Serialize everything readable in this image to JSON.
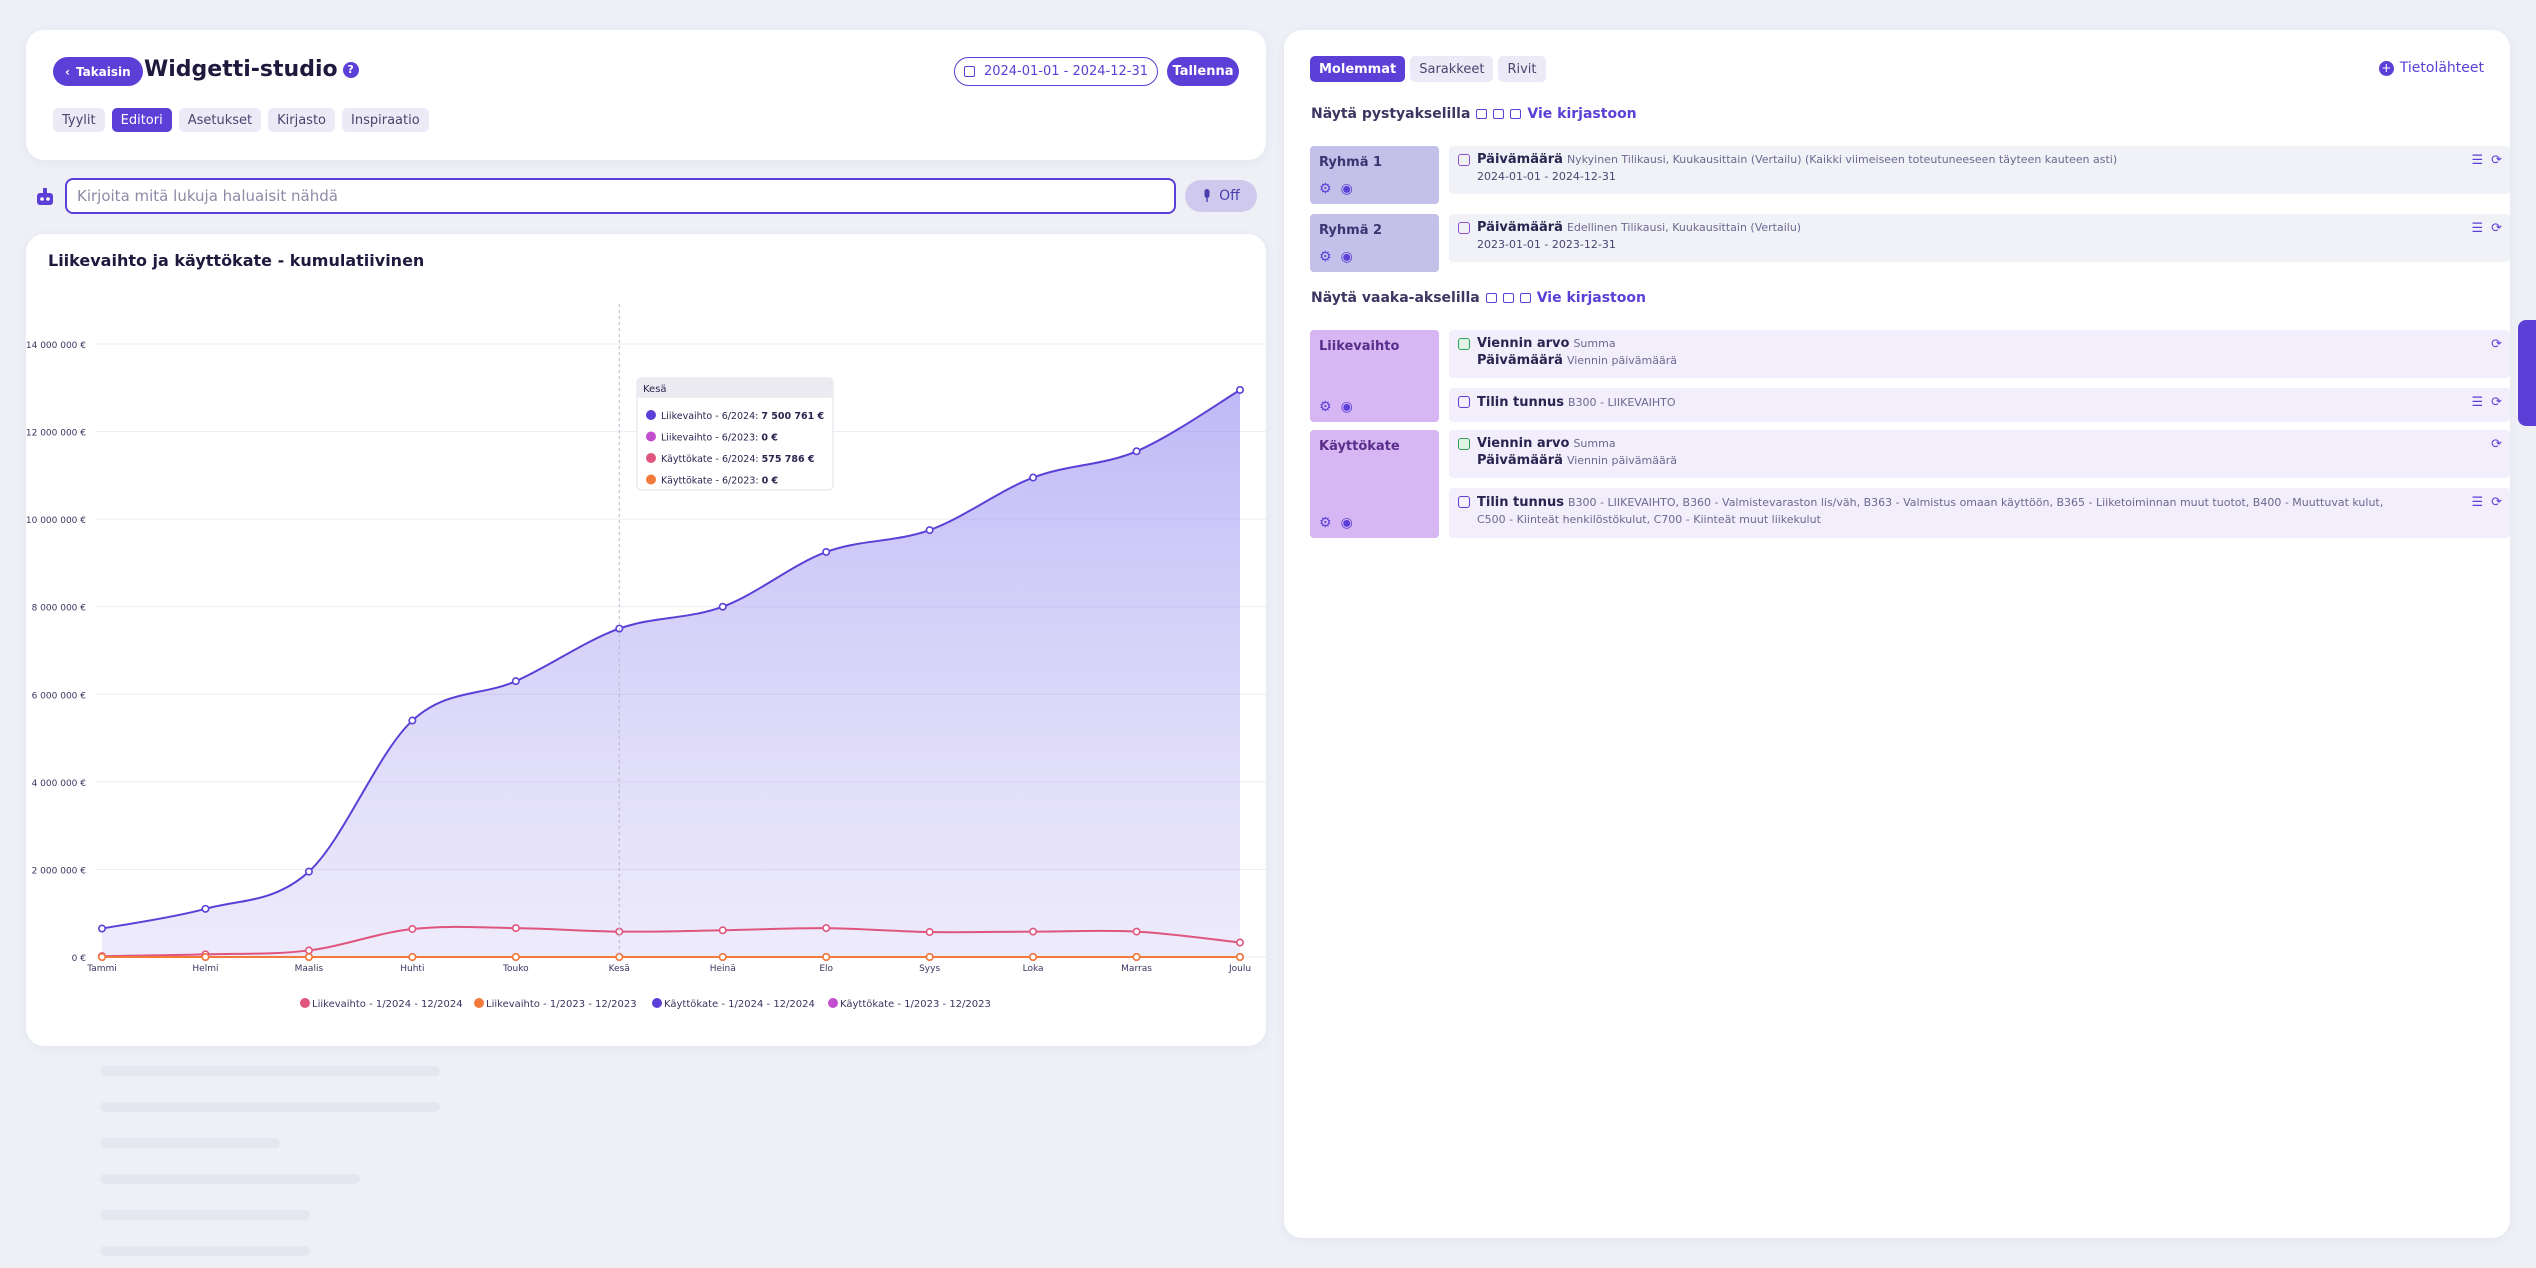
{
  "header": {
    "back_label": "Takaisin",
    "title": "Widgetti-studio",
    "help": "?",
    "date_range": "2024-01-01 - 2024-12-31",
    "save_label": "Tallenna",
    "tabs": [
      "Tyylit",
      "Editori",
      "Asetukset",
      "Kirjasto",
      "Inspiraatio"
    ],
    "active_tab": "Editori"
  },
  "prompt": {
    "placeholder": "Kirjoita mitä lukuja haluaisit nähdä",
    "mic_label": "Off"
  },
  "chart_card": {
    "title": "Liikevaihto ja käyttökate - kumulatiivinen"
  },
  "chart_data": {
    "type": "area",
    "title": "Liikevaihto ja käyttökate - kumulatiivinen",
    "categories": [
      "Tammi",
      "Helmi",
      "Maalis",
      "Huhti",
      "Touko",
      "Kesä",
      "Heinä",
      "Elo",
      "Syys",
      "Loka",
      "Marras",
      "Joulu"
    ],
    "y_ticks": [
      "0 €",
      "2 000 000 €",
      "4 000 000 €",
      "6 000 000 €",
      "8 000 000 €",
      "10 000 000 €",
      "12 000 000 €",
      "14 000 000 €"
    ],
    "ylim": [
      0,
      14000000
    ],
    "legend_position": "bottom",
    "series": [
      {
        "name": "Liikevaihto - 1/2024 - 12/2024",
        "color": "#e0557d",
        "values": [
          20000,
          60000,
          150000,
          640000,
          660000,
          580000,
          610000,
          660000,
          570000,
          580000,
          580000,
          330000
        ]
      },
      {
        "name": "Liikevaihto - 1/2023 - 12/2023",
        "color": "#f27a3a",
        "values": [
          0,
          0,
          0,
          0,
          0,
          0,
          0,
          0,
          0,
          0,
          0,
          0
        ]
      },
      {
        "name": "Käyttökate - 1/2024 - 12/2024",
        "color": "#5b3fd6",
        "values": [
          650000,
          1100000,
          1950000,
          5400000,
          6300000,
          7500761,
          8000000,
          9250000,
          9750000,
          10950000,
          11550000,
          12950000
        ]
      },
      {
        "name": "Käyttökate - 1/2023 - 12/2023",
        "color": "#c34fd0",
        "values": [
          0,
          0,
          0,
          0,
          0,
          0,
          0,
          0,
          0,
          0,
          0,
          0
        ]
      }
    ],
    "tooltip": {
      "title": "Kesä",
      "rows": [
        {
          "label": "Liikevaihto - 6/2024:",
          "value": "7 500 761 €",
          "color": "#5b3fd6"
        },
        {
          "label": "Liikevaihto - 6/2023:",
          "value": "0 €",
          "color": "#c34fd0"
        },
        {
          "label": "Käyttökate - 6/2024:",
          "value": "575 786 €",
          "color": "#e0557d"
        },
        {
          "label": "Käyttökate - 6/2023:",
          "value": "0 €",
          "color": "#f27a3a"
        }
      ]
    }
  },
  "editor": {
    "mode_tabs": [
      "Molemmat",
      "Sarakkeet",
      "Rivit"
    ],
    "active_mode": "Molemmat",
    "sources_label": "Tietolähteet",
    "vertical_title": "Näytä pystyakselilla",
    "horizontal_title": "Näytä vaaka-akselilla",
    "export_label": "Vie kirjastoon",
    "groups": [
      {
        "label": "Ryhmä 1",
        "item_title": "Päivämäärä",
        "item_desc": "Nykyinen Tilikausi, Kuukausittain (Vertailu) (Kaikki viimeiseen toteutuneeseen täyteen kauteen asti)",
        "item_date": "2024-01-01 - 2024-12-31"
      },
      {
        "label": "Ryhmä 2",
        "item_title": "Päivämäärä",
        "item_desc": "Edellinen Tilikausi, Kuukausittain (Vertailu)",
        "item_date": "2023-01-01 - 2023-12-31"
      }
    ],
    "measures": [
      {
        "label": "Liikevaihto",
        "value_title": "Viennin arvo",
        "value_desc": "Summa",
        "date_title": "Päivämäärä",
        "date_desc": "Viennin päivämäärä",
        "account_title": "Tilin tunnus",
        "account_desc": "B300 - LIIKEVAIHTO"
      },
      {
        "label": "Käyttökate",
        "value_title": "Viennin arvo",
        "value_desc": "Summa",
        "date_title": "Päivämäärä",
        "date_desc": "Viennin päivämäärä",
        "account_title": "Tilin tunnus",
        "account_desc": "B300 - LIIKEVAIHTO, B360 - Valmistevaraston lis/väh, B363 - Valmistus omaan käyttöön, B365 - Liiketoiminnan muut tuotot, B400 - Muuttuvat kulut, C500 - Kiinteät henkilöstökulut, C700 - Kiinteät muut liikekulut"
      }
    ]
  }
}
